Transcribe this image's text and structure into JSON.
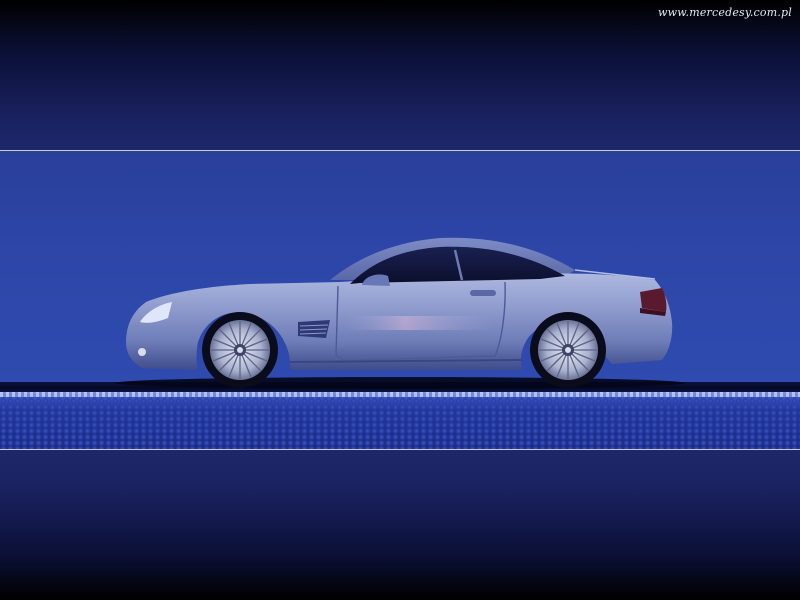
{
  "watermark": {
    "text": "www.mercedesy.com.pl"
  },
  "scene": {
    "subject": "car-side-profile",
    "colors": {
      "band_dark": "#0b1036",
      "backdrop_blue": "#2d46a8",
      "floor_blue": "#1c2c8a",
      "rule_line": "#c9cce0",
      "car_body": "#8c99c8",
      "car_highlight": "#c6cdea",
      "car_shadow": "#3d4a86"
    }
  }
}
